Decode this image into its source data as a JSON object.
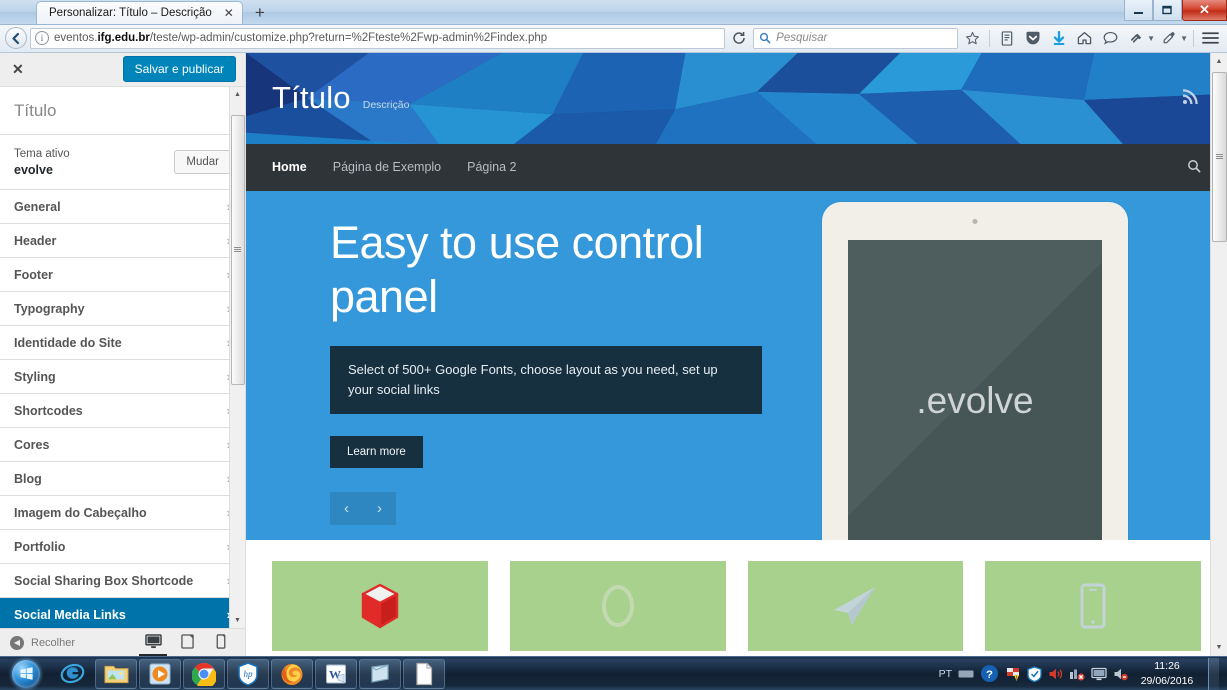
{
  "browser": {
    "tab_title": "Personalizar: Título – Descrição",
    "tab_close_glyph": "✕",
    "newtab_glyph": "+",
    "back_glyph": "←",
    "identity_glyph": "i",
    "url_prefix": "eventos.",
    "url_domain": "ifg.edu.br",
    "url_path": "/teste/wp-admin/customize.php?return=%2Fteste%2Fwp-admin%2Findex.php",
    "reload_glyph": "⟳",
    "search_placeholder": "Pesquisar",
    "window_minimize": "—",
    "window_restore": "❐",
    "window_close": "✕",
    "toolbar_icons": [
      "bookmark-star-icon",
      "library-icon",
      "pocket-icon",
      "downloads-icon",
      "home-icon",
      "chat-icon",
      "plugin-icon",
      "eyedropper-icon",
      "menu-icon"
    ]
  },
  "customizer": {
    "close_label": "✕",
    "publish_label": "Salvar e publicar",
    "panel_title": "Título",
    "theme_label": "Tema ativo",
    "theme_name": "evolve",
    "change_theme_label": "Mudar",
    "chevron": "›",
    "items": [
      {
        "label": "General",
        "active": false
      },
      {
        "label": "Header",
        "active": false
      },
      {
        "label": "Footer",
        "active": false
      },
      {
        "label": "Typography",
        "active": false
      },
      {
        "label": "Identidade do Site",
        "active": false
      },
      {
        "label": "Styling",
        "active": false
      },
      {
        "label": "Shortcodes",
        "active": false
      },
      {
        "label": "Cores",
        "active": false
      },
      {
        "label": "Blog",
        "active": false
      },
      {
        "label": "Imagem do Cabeçalho",
        "active": false
      },
      {
        "label": "Portfolio",
        "active": false
      },
      {
        "label": "Social Sharing Box Shortcode",
        "active": false
      },
      {
        "label": "Social Media Links",
        "active": true
      }
    ],
    "collapse_label": "Recolher",
    "collapse_glyph": "◀",
    "devices": [
      {
        "name": "desktop-view",
        "active": true
      },
      {
        "name": "tablet-view",
        "active": false
      },
      {
        "name": "mobile-view",
        "active": false
      }
    ]
  },
  "preview": {
    "site_title": "Título",
    "site_description": "Descrição",
    "rss_icon": "rss-icon",
    "nav": [
      {
        "label": "Home",
        "active": true
      },
      {
        "label": "Página de Exemplo",
        "active": false
      },
      {
        "label": "Página 2",
        "active": false
      }
    ],
    "search_icon": "search-icon",
    "hero": {
      "heading": "Easy to use control panel",
      "description": "Select of 500+ Google Fonts, choose layout as you need, set up your social links",
      "button_label": "Learn more",
      "prev_glyph": "‹",
      "next_glyph": "›",
      "tablet_logo": ".evolve"
    },
    "features": [
      {
        "icon": "cube-icon",
        "color": "#e02b28"
      },
      {
        "icon": "circle-loop-icon",
        "color": "#c3d9b2"
      },
      {
        "icon": "paper-plane-icon",
        "color": "#c3d4d9"
      },
      {
        "icon": "mobile-phone-icon",
        "color": "#c3d4d9"
      }
    ],
    "feature_bg": "#a8d18d"
  },
  "taskbar": {
    "start_label": "start-orb",
    "apps": [
      "internet-explorer-icon",
      "file-explorer-icon",
      "media-player-icon",
      "chrome-icon",
      "hp-icon",
      "firefox-icon",
      "word-icon",
      "notepad-icon",
      "document-icon"
    ],
    "tray_language": "PT",
    "tray_icons": [
      "keyboard-icon",
      "help-icon",
      "flag-action-center-icon",
      "security-icon",
      "volume-icon",
      "network-error-icon",
      "display-icon",
      "sound-mute-icon"
    ],
    "time": "11:26",
    "date": "29/06/2016"
  },
  "colors": {
    "wp_blue": "#0085ba",
    "wp_active": "#0073aa",
    "hero_blue": "#3498db",
    "dark_navy": "#16303f",
    "nav_dark": "#2f3439",
    "feature_green": "#a8d18d"
  }
}
